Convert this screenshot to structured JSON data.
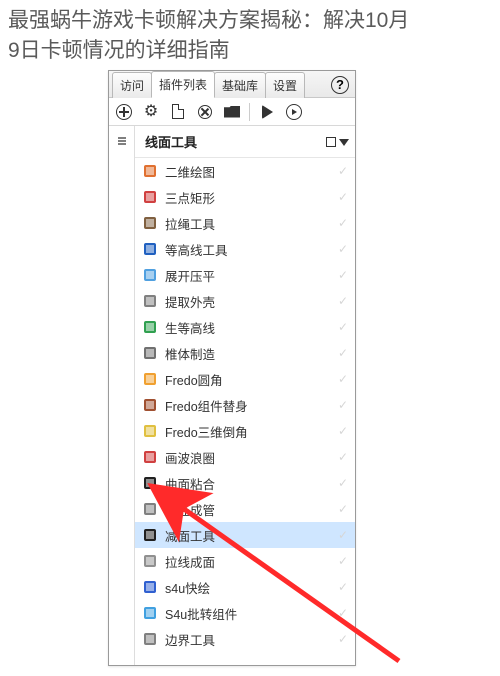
{
  "title_line1": "最强蜗牛游戏卡顿解决方案揭秘：解决10月",
  "title_line2": "9日卡顿情况的详细指南",
  "tabs": {
    "t0": "访问",
    "t1": "插件列表",
    "t2": "基础库",
    "t3": "设置",
    "active": 1
  },
  "toolbar": {
    "add": "add",
    "gear": "settings",
    "doc": "document",
    "cancel": "cancel",
    "folder": "open-folder",
    "play": "play",
    "play_ring": "play-outline"
  },
  "panel": {
    "header": "线面工具"
  },
  "plugins": [
    {
      "label": "二维绘图",
      "icon": "pencil",
      "color": "#e07030"
    },
    {
      "label": "三点矩形",
      "icon": "triangle",
      "color": "#d04040"
    },
    {
      "label": "拉绳工具",
      "icon": "rope",
      "color": "#806040"
    },
    {
      "label": "等高线工具",
      "icon": "contour",
      "color": "#2060c0"
    },
    {
      "label": "展开压平",
      "icon": "flatten",
      "color": "#50a0e0"
    },
    {
      "label": "提取外壳",
      "icon": "shell",
      "color": "#808080"
    },
    {
      "label": "生等高线",
      "icon": "contour2",
      "color": "#30a050"
    },
    {
      "label": "椎体制造",
      "icon": "cone",
      "color": "#707070"
    },
    {
      "label": "Fredo圆角",
      "icon": "fredo-round",
      "color": "#f0a030"
    },
    {
      "label": "Fredo组件替身",
      "icon": "fredo-ghost",
      "color": "#a05030"
    },
    {
      "label": "Fredo三维倒角",
      "icon": "fredo-bevel",
      "color": "#e0c040"
    },
    {
      "label": "画波浪圈",
      "icon": "wave",
      "color": "#d04040"
    },
    {
      "label": "曲面粘合",
      "icon": "curve",
      "color": "#202020"
    },
    {
      "label": "路径成管",
      "icon": "pipe",
      "color": "#808080"
    },
    {
      "label": "减面工具",
      "icon": "reduce",
      "color": "#202020",
      "selected": true
    },
    {
      "label": "拉线成面",
      "icon": "extrude",
      "color": "#909090"
    },
    {
      "label": "s4u快绘",
      "icon": "s4u",
      "color": "#3060d0"
    },
    {
      "label": "S4u批转组件",
      "icon": "s4u-batch",
      "color": "#40a0e0"
    },
    {
      "label": "边界工具",
      "icon": "edge",
      "color": "#808080"
    }
  ]
}
